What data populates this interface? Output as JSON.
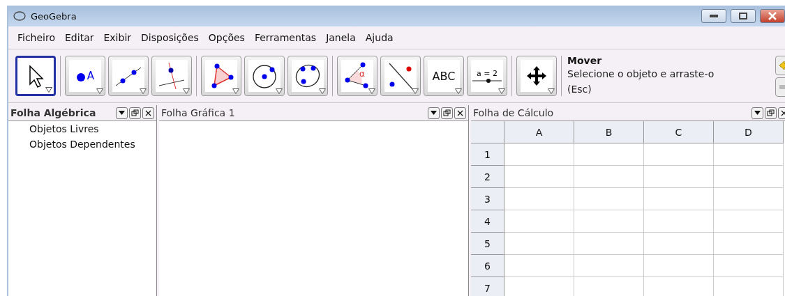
{
  "window": {
    "title": "GeoGebra"
  },
  "menu": [
    "Ficheiro",
    "Editar",
    "Exibir",
    "Disposições",
    "Opções",
    "Ferramentas",
    "Janela",
    "Ajuda"
  ],
  "toolbar": {
    "tools": [
      {
        "kind": "move",
        "selected": true
      },
      {
        "kind": "point",
        "label": "A",
        "selected": false
      },
      {
        "kind": "line",
        "selected": false
      },
      {
        "kind": "perpendicular",
        "selected": false
      },
      {
        "kind": "polygon",
        "selected": false
      },
      {
        "kind": "circle",
        "selected": false
      },
      {
        "kind": "conic",
        "selected": false
      },
      {
        "kind": "angle",
        "label": "α",
        "selected": false
      },
      {
        "kind": "reflect",
        "selected": false
      },
      {
        "kind": "text",
        "label": "ABC",
        "selected": false
      },
      {
        "kind": "slider",
        "label": "a = 2",
        "selected": false
      },
      {
        "kind": "moveview",
        "selected": false
      }
    ],
    "help": {
      "title": "Mover",
      "text": "Selecione o objeto e arraste-o",
      "shortcut": "(Esc)"
    }
  },
  "algebra": {
    "title": "Folha Algébrica",
    "items": [
      "Objetos Livres",
      "Objetos Dependentes"
    ]
  },
  "graphics": {
    "title": "Folha Gráfica 1"
  },
  "spreadsheet": {
    "title": "Folha de Cálculo",
    "columns": [
      "A",
      "B",
      "C",
      "D"
    ],
    "rows": [
      "1",
      "2",
      "3",
      "4",
      "5",
      "6",
      "7"
    ]
  }
}
